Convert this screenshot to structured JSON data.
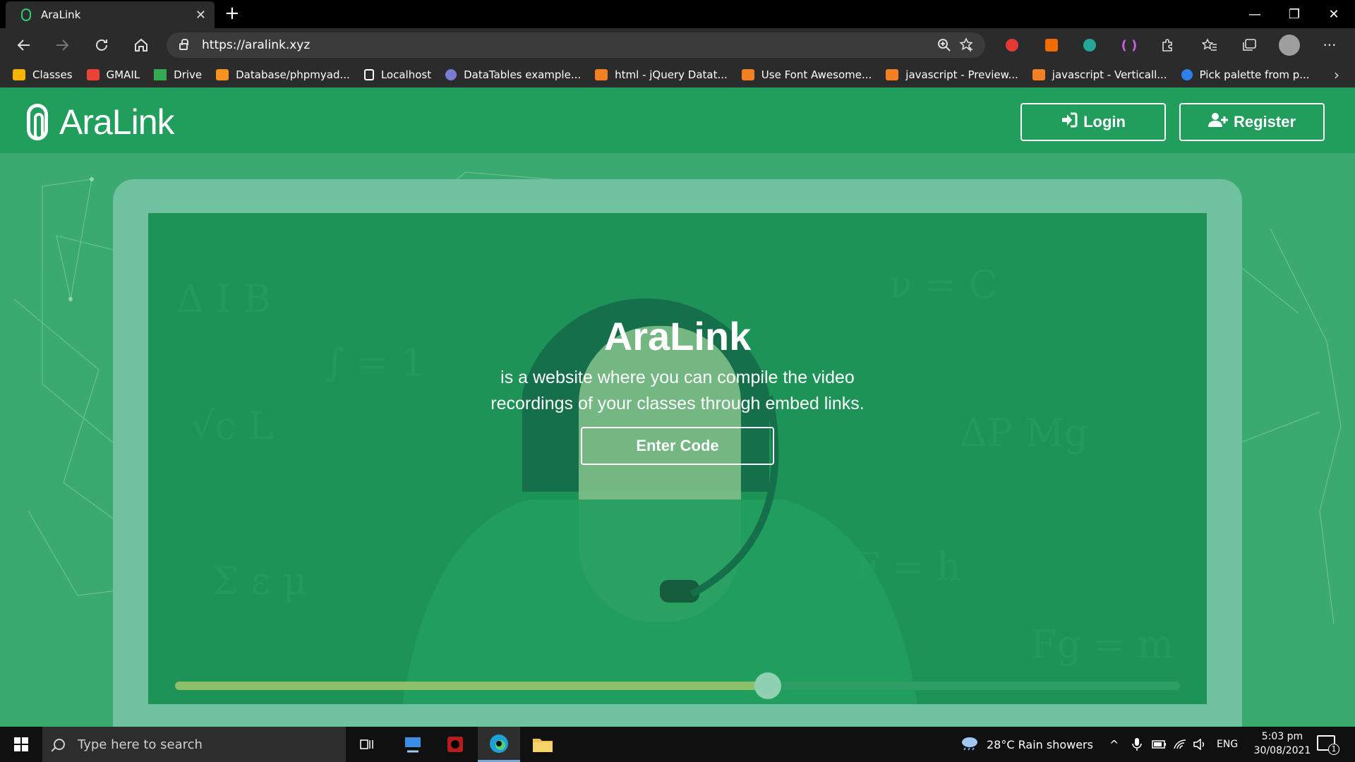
{
  "browser": {
    "tab_title": "AraLink",
    "url": "https://aralink.xyz",
    "new_tab_symbol": "+",
    "tab_close_symbol": "✕",
    "window_controls": {
      "minimize": "—",
      "restore": "❐",
      "close": "✕"
    },
    "bookmarks": [
      {
        "label": "Classes",
        "icon": "google-classroom-icon",
        "color": "#f4b400"
      },
      {
        "label": "GMAIL",
        "icon": "gmail-icon",
        "color": "#ea4335"
      },
      {
        "label": "Drive",
        "icon": "google-drive-icon",
        "color": "#34a853"
      },
      {
        "label": "Database/phpmyad...",
        "icon": "phpmyadmin-icon",
        "color": "#f7931e"
      },
      {
        "label": "Localhost",
        "icon": "page-icon",
        "color": "#ffffff"
      },
      {
        "label": "DataTables example...",
        "icon": "datatables-icon",
        "color": "#7b7bd6"
      },
      {
        "label": "html - jQuery Datat...",
        "icon": "stackoverflow-icon",
        "color": "#f48024"
      },
      {
        "label": "Use Font Awesome...",
        "icon": "stackoverflow-icon",
        "color": "#f48024"
      },
      {
        "label": "javascript - Preview...",
        "icon": "stackoverflow-icon",
        "color": "#f48024"
      },
      {
        "label": "javascript - Verticall...",
        "icon": "stackoverflow-icon",
        "color": "#f48024"
      },
      {
        "label": "Pick palette from p...",
        "icon": "palette-site-icon",
        "color": "#2f80ed"
      }
    ]
  },
  "header": {
    "logo_text": "AraLink",
    "login_label": "Login",
    "register_label": "Register"
  },
  "hero": {
    "title": "AraLink",
    "description": "is a website where you can compile the video recordings of your classes through embed links.",
    "enter_code_label": "Enter Code",
    "video_progress": 0.59
  },
  "colors": {
    "header_bg": "#219e5c",
    "page_bg": "#3aaa70",
    "screen_bg": "#1d9357",
    "monitor_frame": "#70c1a0",
    "progress_fill": "#8cc068"
  },
  "taskbar": {
    "search_placeholder": "Type here to search",
    "weather": "28°C  Rain showers",
    "language": "ENG",
    "time": "5:03 pm",
    "date": "30/08/2021",
    "notification_count": "1"
  }
}
